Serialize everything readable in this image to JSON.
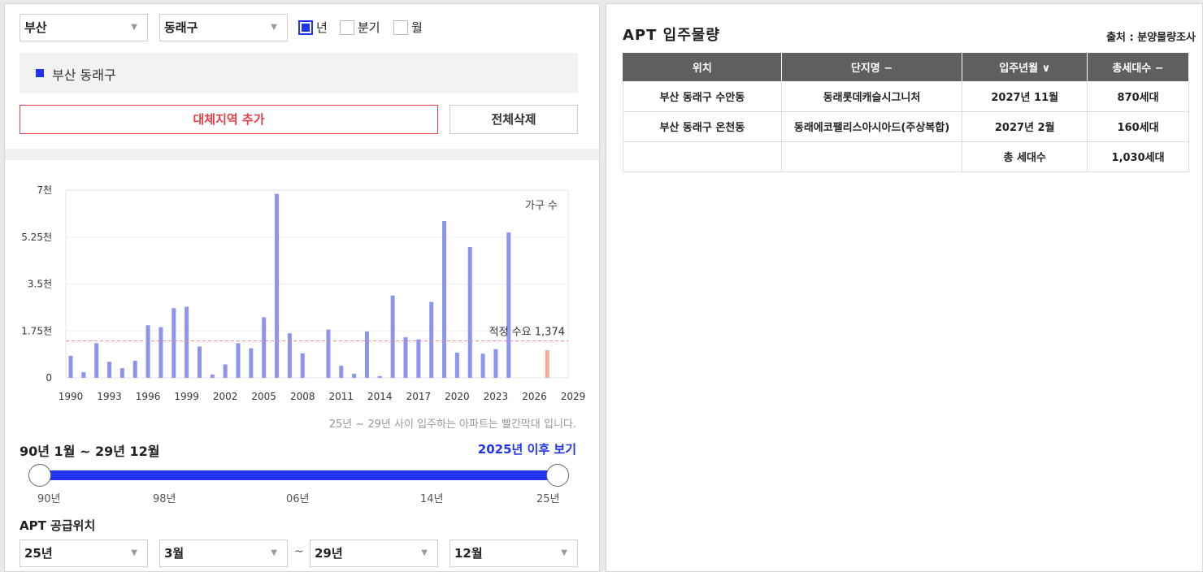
{
  "filters": {
    "city": "부산",
    "district": "동래구",
    "period_options": [
      {
        "label": "년",
        "checked": true
      },
      {
        "label": "분기",
        "checked": false
      },
      {
        "label": "월",
        "checked": false
      }
    ]
  },
  "selected_region": "부산 동래구",
  "buttons": {
    "add_region": "대체지역 추가",
    "delete_all": "전체삭제"
  },
  "chart_data": {
    "type": "bar",
    "legend": "가구 수",
    "y_ticks": [
      "7천",
      "5.25천",
      "3.5천",
      "1.75천",
      "0"
    ],
    "ylim": [
      0,
      7000
    ],
    "x_ticks": [
      "1990",
      "1993",
      "1996",
      "1999",
      "2002",
      "2005",
      "2008",
      "2011",
      "2014",
      "2017",
      "2020",
      "2023",
      "2026",
      "2029"
    ],
    "xlim": [
      1990,
      2029
    ],
    "reference_line": {
      "label": "적정 수요 1,374",
      "value": 1374
    },
    "bars": [
      {
        "year": 1990,
        "value": 820
      },
      {
        "year": 1991,
        "value": 210
      },
      {
        "year": 1992,
        "value": 1290
      },
      {
        "year": 1993,
        "value": 600
      },
      {
        "year": 1994,
        "value": 360
      },
      {
        "year": 1995,
        "value": 640
      },
      {
        "year": 1996,
        "value": 1960
      },
      {
        "year": 1997,
        "value": 1890
      },
      {
        "year": 1998,
        "value": 2600
      },
      {
        "year": 1999,
        "value": 2650
      },
      {
        "year": 2000,
        "value": 1170
      },
      {
        "year": 2001,
        "value": 120
      },
      {
        "year": 2002,
        "value": 500
      },
      {
        "year": 2003,
        "value": 1290
      },
      {
        "year": 2004,
        "value": 1100
      },
      {
        "year": 2005,
        "value": 2260
      },
      {
        "year": 2006,
        "value": 6860
      },
      {
        "year": 2007,
        "value": 1660
      },
      {
        "year": 2008,
        "value": 910
      },
      {
        "year": 2010,
        "value": 1800
      },
      {
        "year": 2011,
        "value": 450
      },
      {
        "year": 2012,
        "value": 150
      },
      {
        "year": 2013,
        "value": 1730
      },
      {
        "year": 2014,
        "value": 60
      },
      {
        "year": 2015,
        "value": 3070
      },
      {
        "year": 2016,
        "value": 1510
      },
      {
        "year": 2017,
        "value": 1430
      },
      {
        "year": 2018,
        "value": 2830
      },
      {
        "year": 2019,
        "value": 5850
      },
      {
        "year": 2020,
        "value": 940
      },
      {
        "year": 2021,
        "value": 4880
      },
      {
        "year": 2022,
        "value": 900
      },
      {
        "year": 2023,
        "value": 1070
      },
      {
        "year": 2024,
        "value": 5420
      },
      {
        "year": 2027,
        "value": 1030,
        "future": true
      }
    ],
    "colors": {
      "bar": "#8a95f0",
      "future": "#f5a899",
      "reference": "#e88a8a"
    }
  },
  "chart_note": "25년 ~ 29년 사이 입주하는 아파트는 빨간막대 입니다.",
  "range": {
    "title": "90년 1월 ~ 29년 12월",
    "link": "2025년 이후 보기",
    "labels": [
      "90년",
      "98년",
      "06년",
      "14년",
      "25년"
    ]
  },
  "supply": {
    "title": "APT 공급위치",
    "from_year": "25년",
    "from_month": "3월",
    "separator": "~",
    "to_year": "29년",
    "to_month": "12월"
  },
  "right_panel": {
    "title": "APT 입주물량",
    "source": "출처 : 분양물량조사",
    "columns": [
      "위치",
      "단지명 −",
      "입주년월 ∨",
      "총세대수 −"
    ],
    "rows": [
      [
        "부산 동래구 수안동",
        "동래롯데캐슬시그니처",
        "2027년 11월",
        "870세대"
      ],
      [
        "부산 동래구 온천동",
        "동래에코팰리스아시아드(주상복합)",
        "2027년 2월",
        "160세대"
      ],
      [
        "",
        "",
        "총 세대수",
        "1,030세대"
      ]
    ]
  }
}
